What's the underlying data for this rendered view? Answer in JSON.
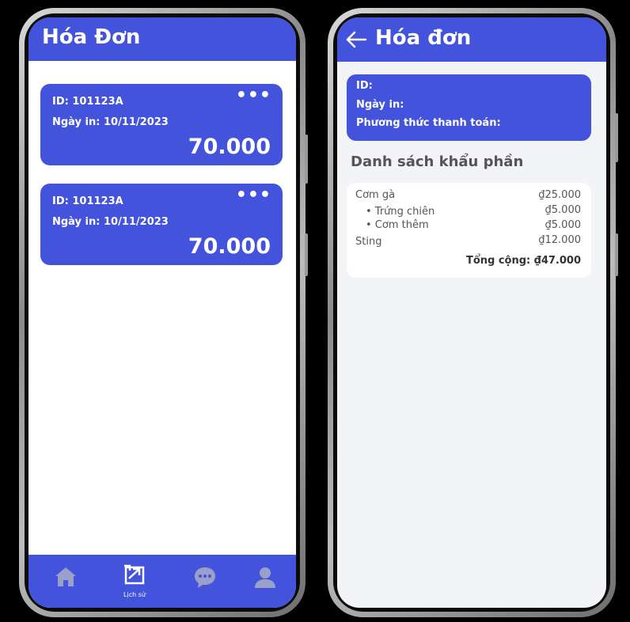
{
  "invoice_list_screen": {
    "title": "Hóa Đơn",
    "cards": [
      {
        "id_label": "ID: 101123A",
        "date_label": "Ngày in: 10/11/2023",
        "amount": "70.000",
        "more": "•••"
      },
      {
        "id_label": "ID: 101123A",
        "date_label": "Ngày in: 10/11/2023",
        "amount": "70.000",
        "more": "•••"
      }
    ],
    "bottom_nav": {
      "history_label": "Lịch sử"
    }
  },
  "invoice_detail_screen": {
    "title": "Hóa đơn",
    "info": {
      "id_label": "ID:",
      "date_label": "Ngày in:",
      "payment_label": "Phương thức thanh toán:"
    },
    "section_title": "Danh sách khẩu phần",
    "items": [
      {
        "name": "Cơm gà",
        "price": "₫25.000"
      },
      {
        "name": "• Trứng chiên",
        "price": "₫5.000"
      },
      {
        "name": "• Cơm thêm",
        "price": "₫5.000"
      },
      {
        "name": "Sting",
        "price": "₫12.000"
      }
    ],
    "total": "Tổng cộng: ₫47.000"
  },
  "colors": {
    "primary": "#4353dc",
    "background_detail": "#f3f4f8",
    "nav_icon": "#9aa0c8"
  }
}
